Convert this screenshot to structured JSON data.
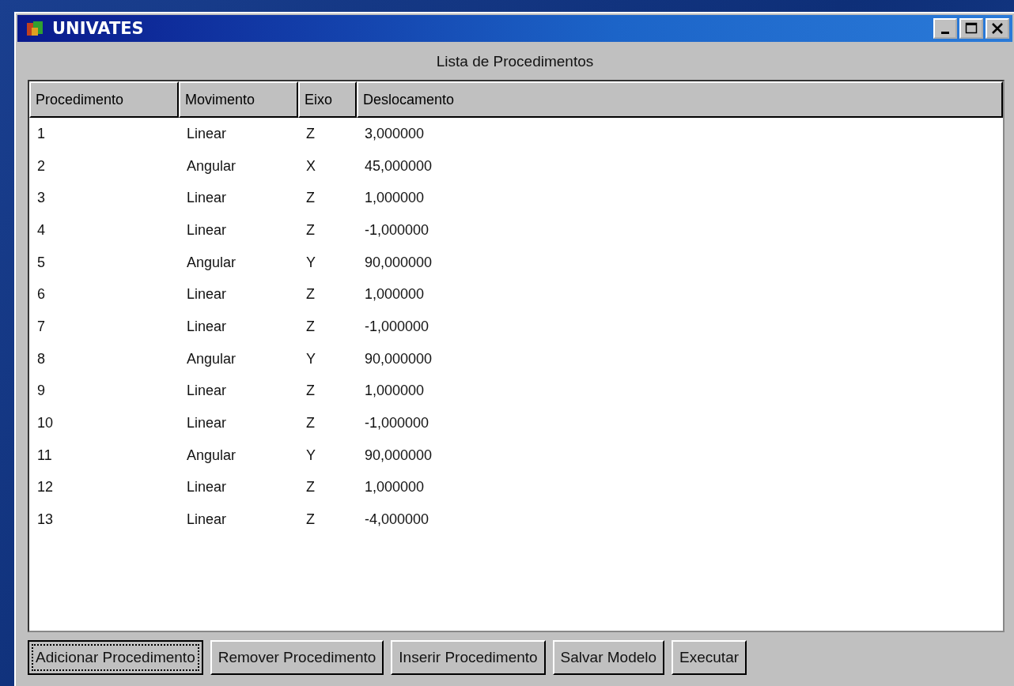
{
  "window": {
    "title": "UNIVATES"
  },
  "heading": "Lista de Procedimentos",
  "table": {
    "columns": [
      "Procedimento",
      "Movimento",
      "Eixo",
      "Deslocamento"
    ],
    "rows": [
      [
        "1",
        "Linear",
        "Z",
        "3,000000"
      ],
      [
        "2",
        "Angular",
        "X",
        "45,000000"
      ],
      [
        "3",
        "Linear",
        "Z",
        "1,000000"
      ],
      [
        "4",
        "Linear",
        "Z",
        "-1,000000"
      ],
      [
        "5",
        "Angular",
        "Y",
        "90,000000"
      ],
      [
        "6",
        "Linear",
        "Z",
        "1,000000"
      ],
      [
        "7",
        "Linear",
        "Z",
        "-1,000000"
      ],
      [
        "8",
        "Angular",
        "Y",
        "90,000000"
      ],
      [
        "9",
        "Linear",
        "Z",
        "1,000000"
      ],
      [
        "10",
        "Linear",
        "Z",
        "-1,000000"
      ],
      [
        "11",
        "Angular",
        "Y",
        "90,000000"
      ],
      [
        "12",
        "Linear",
        "Z",
        "1,000000"
      ],
      [
        "13",
        "Linear",
        "Z",
        "-4,000000"
      ]
    ]
  },
  "buttons": [
    {
      "label": "Adicionar Procedimento",
      "focused": true
    },
    {
      "label": "Remover Procedimento",
      "focused": false
    },
    {
      "label": "Inserir Procedimento",
      "focused": false
    },
    {
      "label": "Salvar Modelo",
      "focused": false
    },
    {
      "label": "Executar",
      "focused": false
    }
  ]
}
